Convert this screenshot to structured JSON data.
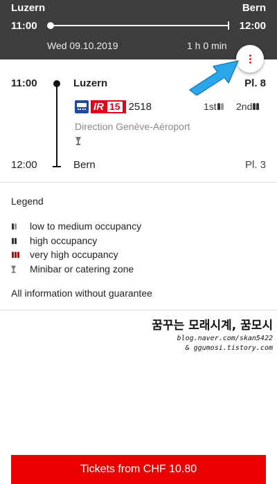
{
  "header": {
    "from": "Luzern",
    "to": "Bern",
    "departure": "11:00",
    "arrival": "12:00",
    "date": "Wed 09.10.2019",
    "duration": "1 h 0 min",
    "menu_icon": "more-vertical-icon"
  },
  "connection": {
    "departure_time": "11:00",
    "departure_station": "Luzern",
    "departure_platform": "Pl. 8",
    "arrival_time": "12:00",
    "arrival_station": "Bern",
    "arrival_platform": "Pl. 3",
    "train_category": "IR",
    "train_line": "15",
    "train_number": "2518",
    "first_class": "1st",
    "second_class": "2nd",
    "direction": "Direction Genève-Aéroport"
  },
  "legend": {
    "title": "Legend",
    "items": [
      {
        "icon": "occupancy-low-icon",
        "label": "low to medium occupancy"
      },
      {
        "icon": "occupancy-high-icon",
        "label": "high occupancy"
      },
      {
        "icon": "occupancy-very-high-icon",
        "label": "very high occupancy"
      },
      {
        "icon": "minibar-icon",
        "label": "Minibar or catering zone"
      }
    ],
    "disclaimer": "All information without guarantee"
  },
  "watermark": {
    "title": "꿈꾸는 모래시계, 꿈모시",
    "line1": "blog.naver.com/skan5422",
    "line2": "& ggumosi.tistory.com"
  },
  "tickets_button": "Tickets from CHF 10.80",
  "colors": {
    "header_bg": "#3d3d3d",
    "sbb_red": "#eb0000",
    "ir_red": "#e2001a",
    "accent_blue": "#2aa7e8"
  }
}
